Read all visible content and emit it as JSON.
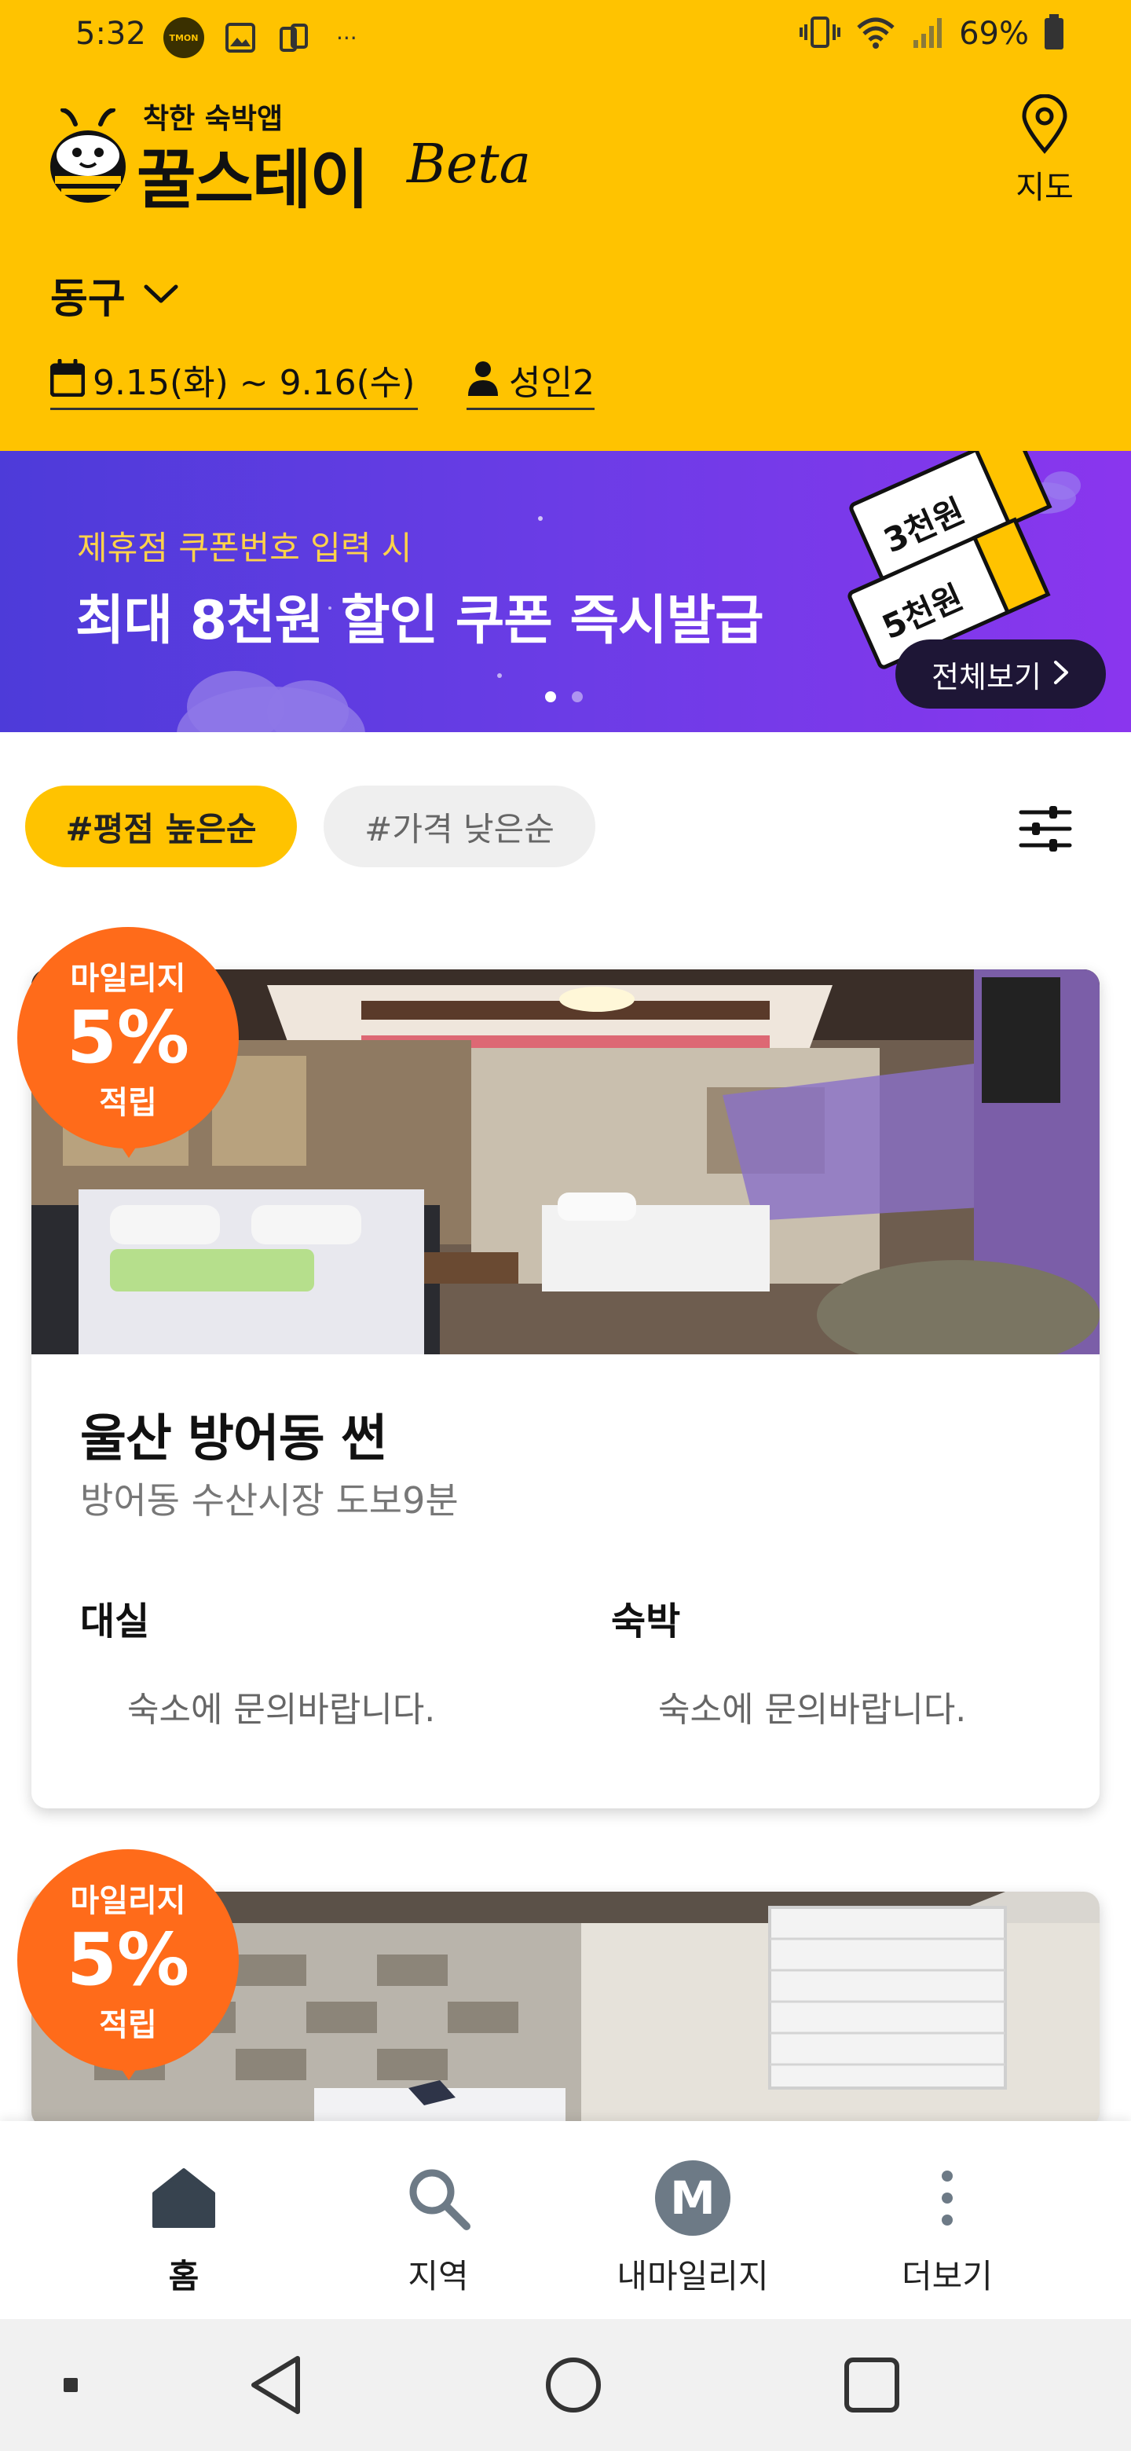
{
  "status_bar": {
    "time": "5:32",
    "tmon": "TMON",
    "battery": "69%",
    "more": "···"
  },
  "header": {
    "brand_tag": "착한 숙박앱",
    "brand_name": "꿀스테이",
    "brand_beta": "Beta",
    "map_label": "지도",
    "region": "동구",
    "date_range": "9.15(화) ~ 9.16(수)",
    "guests": "성인2",
    "background_color": "#FFC300"
  },
  "banner": {
    "subtitle": "제휴점 쿠폰번호 입력 시",
    "title": "최대 8천원 할인 쿠폰  즉시발급",
    "ticket_1": "3천원",
    "ticket_2": "5천원",
    "view_all": "전체보기",
    "slide_count": 2,
    "active_slide": 1
  },
  "filters": {
    "chips": [
      {
        "label": "#평점 높은순",
        "active": true
      },
      {
        "label": "#가격 낮은순",
        "active": false
      }
    ]
  },
  "listings": [
    {
      "badge_top": "마일리지",
      "badge_pct": "5%",
      "badge_bottom": "적립",
      "name": "울산 방어동 썬",
      "description": "방어동 수산시장 도보9분",
      "prices": [
        {
          "type": "대실",
          "note": "숙소에 문의바랍니다."
        },
        {
          "type": "숙박",
          "note": "숙소에 문의바랍니다."
        }
      ]
    },
    {
      "badge_top": "마일리지",
      "badge_pct": "5%",
      "badge_bottom": "적립"
    }
  ],
  "bottom_nav": {
    "items": [
      {
        "label": "홈",
        "icon": "home-icon",
        "active": true
      },
      {
        "label": "지역",
        "icon": "search-icon",
        "active": false
      },
      {
        "label": "내마일리지",
        "icon": "mileage-icon",
        "active": false
      },
      {
        "label": "더보기",
        "icon": "more-vertical-icon",
        "active": false
      }
    ],
    "mileage_glyph": "M"
  },
  "colors": {
    "brand_yellow": "#FFC300",
    "badge_orange": "#FF6B1A",
    "banner_purple": "#6B3CE6",
    "banner_highlight": "#FFD24A"
  }
}
